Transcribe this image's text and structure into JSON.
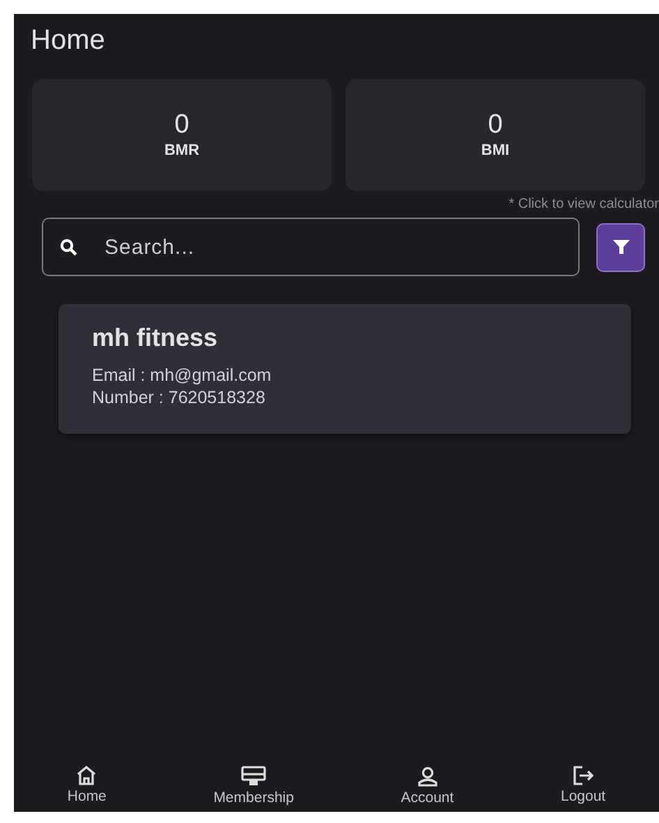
{
  "header": {
    "title": "Home"
  },
  "stats": [
    {
      "value": "0",
      "label": "BMR"
    },
    {
      "value": "0",
      "label": "BMI"
    }
  ],
  "calculator_hint": "* Click to view calculator",
  "search": {
    "placeholder": "Search..."
  },
  "gyms": [
    {
      "name": "mh fitness",
      "email": "Email : mh@gmail.com",
      "number": "Number : 7620518328"
    }
  ],
  "nav": [
    {
      "kind": "home",
      "label": "Home"
    },
    {
      "kind": "membership",
      "label": "Membership"
    },
    {
      "kind": "account",
      "label": "Account"
    },
    {
      "kind": "logout",
      "label": "Logout"
    }
  ]
}
